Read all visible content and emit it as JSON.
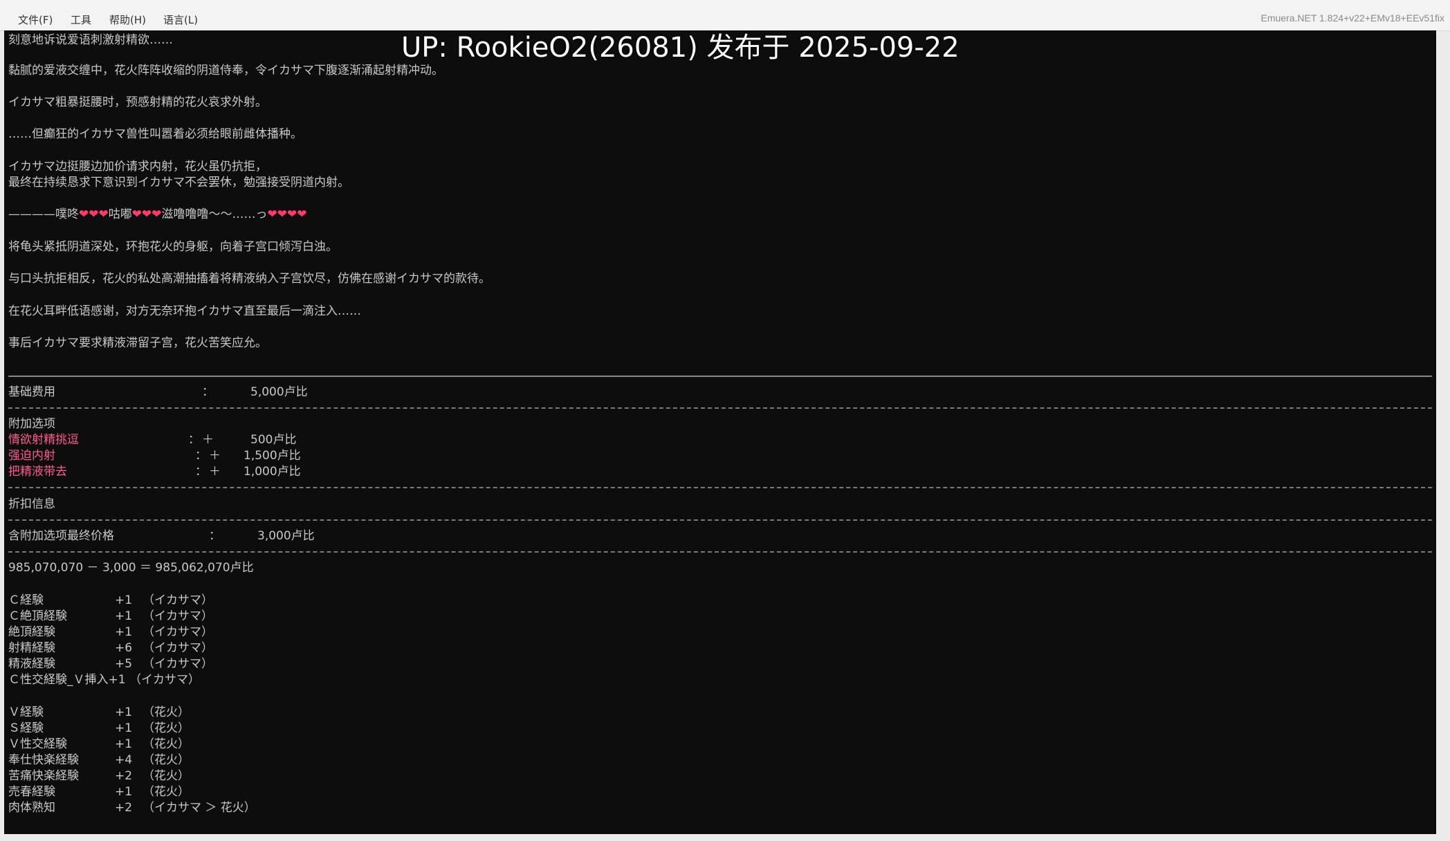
{
  "menubar": {
    "items": [
      "文件(F)",
      "工具",
      "帮助(H)",
      "语言(L)"
    ],
    "version": "Emuera.NET 1.824+v22+EMv18+EEv51fix"
  },
  "overlay": {
    "title": "UP: RookieO2(26081) 发布于 2025-09-22"
  },
  "story": {
    "line0": "刻意地诉说爱语刺激射精欲……",
    "line1": "黏腻的爱液交缠中，花火阵阵收缩的阴道侍奉，令イカサマ下腹逐渐涌起射精冲动。",
    "line2": "イカサマ粗暴挺腰时，预感射精的花火哀求外射。",
    "line3": "……但癫狂的イカサマ兽性叫嚣着必须给眼前雌体播种。",
    "line4": "イカサマ边挺腰边加价请求内射，花火虽仍抗拒，",
    "line5": "最终在持续恳求下意识到イカサマ不会罢休，勉强接受阴道内射。",
    "line6a": "————噗咚",
    "line6b": "❤❤❤",
    "line6c": "咕嘟",
    "line6d": "❤❤❤",
    "line6e": "滋噜噜噜～～……っ",
    "line6f": "❤❤❤❤",
    "line7": "将龟头紧抵阴道深处，环抱花火的身躯，向着子宫口倾泻白浊。",
    "line8": "与口头抗拒相反，花火的私处高潮抽搐着将精液纳入子宫饮尽，仿佛在感谢イカサマ的款待。",
    "line9": "在花火耳畔低语感谢，对方无奈环抱イカサマ直至最后一滴注入……",
    "line10": "事后イカサマ要求精液滞留子宫，花火苦笑应允。"
  },
  "pricing": {
    "base_label": "基础费用",
    "base_sep": "：",
    "base_value": "5,000卢比",
    "options_header": "附加选项",
    "options": [
      {
        "label": "情欲射精挑逗",
        "sep": "：",
        "sign": "＋",
        "value": "500卢比"
      },
      {
        "label": "强迫内射",
        "sep": "：",
        "sign": "＋",
        "value": "1,500卢比"
      },
      {
        "label": "把精液带去",
        "sep": "：",
        "sign": "＋",
        "value": "1,000卢比"
      }
    ],
    "discount_label": "折扣信息",
    "final_label": "含附加选项最终价格",
    "final_sep": "：",
    "final_value": "3,000卢比",
    "balance": "985,070,070 － 3,000 ＝ 985,062,070卢比"
  },
  "exp": {
    "ikasama": [
      {
        "label": "Ｃ経験",
        "delta": "+1",
        "who": "（イカサマ）"
      },
      {
        "label": "Ｃ絶頂経験",
        "delta": "+1",
        "who": "（イカサマ）"
      },
      {
        "label": "絶頂経験",
        "delta": "+1",
        "who": "（イカサマ）"
      },
      {
        "label": "射精経験",
        "delta": "+6",
        "who": "（イカサマ）"
      },
      {
        "label": "精液経験",
        "delta": "+5",
        "who": "（イカサマ）"
      }
    ],
    "combo": "Ｃ性交経験_Ｖ挿入+1 （イカサマ）",
    "hanabi": [
      {
        "label": "Ｖ経験",
        "delta": "+1",
        "who": "（花火）"
      },
      {
        "label": "Ｓ経験",
        "delta": "+1",
        "who": "（花火）"
      },
      {
        "label": "Ｖ性交経験",
        "delta": "+1",
        "who": "（花火）"
      },
      {
        "label": "奉仕快楽経験",
        "delta": "+4",
        "who": "（花火）"
      },
      {
        "label": "苦痛快楽経験",
        "delta": "+2",
        "who": "（花火）"
      },
      {
        "label": "売春経験",
        "delta": "+1",
        "who": "（花火）"
      },
      {
        "label": "肉体熟知",
        "delta": "+2",
        "who": "（イカサマ ＞ 花火）"
      }
    ]
  }
}
